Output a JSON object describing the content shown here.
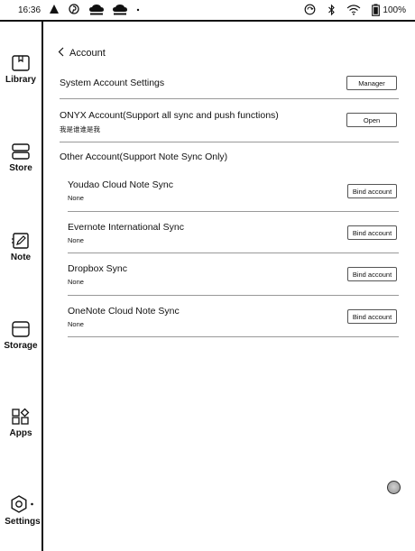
{
  "status_bar": {
    "time": "16:36",
    "battery": "100%",
    "icons": [
      "alert-icon",
      "pinterest-icon",
      "cloud-upload-icon",
      "cloud-upload-icon",
      "dot-icon",
      "sync-icon",
      "bluetooth-icon",
      "wifi-icon",
      "battery-icon"
    ]
  },
  "sidebar": {
    "items": [
      {
        "label": "Library",
        "icon": "library-icon"
      },
      {
        "label": "Store",
        "icon": "store-icon"
      },
      {
        "label": "Note",
        "icon": "note-icon"
      },
      {
        "label": "Storage",
        "icon": "storage-icon"
      },
      {
        "label": "Apps",
        "icon": "apps-icon"
      },
      {
        "label": "Settings",
        "icon": "settings-icon"
      }
    ]
  },
  "header": {
    "back_label": "Account"
  },
  "system_account": {
    "label": "System Account Settings",
    "button": "Manager"
  },
  "onyx_account": {
    "label": "ONYX Account(Support all sync and push functions)",
    "user": "我是谁谁是我",
    "button": "Open"
  },
  "other_account": {
    "label": "Other Account(Support Note Sync Only)"
  },
  "sync_services": [
    {
      "name": "Youdao Cloud Note Sync",
      "status": "None",
      "button": "Bind account"
    },
    {
      "name": "Evernote International Sync",
      "status": "None",
      "button": "Bind account"
    },
    {
      "name": "Dropbox Sync",
      "status": "None",
      "button": "Bind account"
    },
    {
      "name": "OneNote Cloud Note Sync",
      "status": "None",
      "button": "Bind account"
    }
  ],
  "colors": {
    "ink": "#111111",
    "divider": "#999999",
    "background": "#ffffff"
  }
}
